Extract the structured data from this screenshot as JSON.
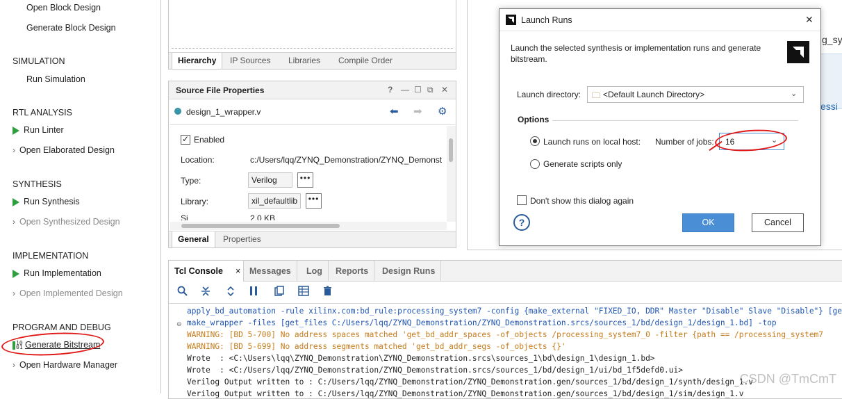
{
  "flow_navigator": {
    "open_block_design": "Open Block Design",
    "generate_block_design": "Generate Block Design",
    "simulation": "SIMULATION",
    "run_simulation": "Run Simulation",
    "rtl_analysis": "RTL ANALYSIS",
    "run_linter": "Run Linter",
    "open_elaborated_design": "Open Elaborated Design",
    "synthesis": "SYNTHESIS",
    "run_synthesis": "Run Synthesis",
    "open_synthesized_design": "Open Synthesized Design",
    "implementation": "IMPLEMENTATION",
    "run_implementation": "Run Implementation",
    "open_implemented_design": "Open Implemented Design",
    "program_and_debug": "PROGRAM AND DEBUG",
    "generate_bitstream": "Generate Bitstream",
    "open_hardware_manager": "Open Hardware Manager"
  },
  "sources_tabs": [
    "Hierarchy",
    "IP Sources",
    "Libraries",
    "Compile Order"
  ],
  "source_file_properties": {
    "title": "Source File Properties",
    "file_name": "design_1_wrapper.v",
    "enabled_label": "Enabled",
    "location_label": "Location:",
    "location_value": "c:/Users/lqq/ZYNQ_Demonstration/ZYNQ_Demonst",
    "type_label": "Type:",
    "type_value": "Verilog",
    "library_label": "Library:",
    "library_value": "xil_defaultlib",
    "size_label": "Si",
    "size_value": "2.0 KB",
    "tabs": [
      "General",
      "Properties"
    ],
    "dots": "•••"
  },
  "right_peek": {
    "text1": "g_sy",
    "text2": "essi"
  },
  "console": {
    "tabs": [
      "Tcl Console",
      "Messages",
      "Log",
      "Reports",
      "Design Runs"
    ],
    "close": "×",
    "lines": [
      {
        "type": "cmd",
        "text": "apply_bd_automation -rule xilinx.com:bd_rule:processing_system7 -config {make_external \"FIXED_IO, DDR\" Master \"Disable\" Slave \"Disable\"} [get_"
      },
      {
        "type": "cmd",
        "text": "make_wrapper -files [get_files C:/Users/lqq/ZYNQ_Demonstration/ZYNQ_Demonstration.srcs/sources_1/bd/design_1/design_1.bd] -top"
      },
      {
        "type": "warn",
        "text": "WARNING: [BD 5-700] No address spaces matched 'get_bd_addr_spaces -of_objects /processing_system7_0 -filter {path == /processing_system7"
      },
      {
        "type": "warn",
        "text": "WARNING: [BD 5-699] No address segments matched 'get_bd_addr_segs -of_objects {}'"
      },
      {
        "type": "out",
        "text": "Wrote  : <C:\\Users\\lqq\\ZYNQ_Demonstration\\ZYNQ_Demonstration.srcs\\sources_1\\bd\\design_1\\design_1.bd>"
      },
      {
        "type": "out",
        "text": "Wrote  : <C:/Users/lqq/ZYNQ_Demonstration/ZYNQ_Demonstration.srcs/sources_1/bd/design_1/ui/bd_1f5defd0.ui>"
      },
      {
        "type": "out",
        "text": "Verilog Output written to : C:/Users/lqq/ZYNQ_Demonstration/ZYNQ_Demonstration.gen/sources_1/bd/design_1/synth/design_1.v"
      },
      {
        "type": "out",
        "text": "Verilog Output written to : C:/Users/lqq/ZYNQ_Demonstration/ZYNQ_Demonstration.gen/sources_1/bd/design_1/sim/design_1.v"
      }
    ]
  },
  "dialog": {
    "title": "Launch Runs",
    "close": "✕",
    "description": "Launch the selected synthesis or implementation runs and generate bitstream.",
    "launch_directory_label": "Launch directory:",
    "launch_directory_value": "<Default Launch Directory>",
    "options_label": "Options",
    "local_host_label": "Launch runs on local host:",
    "jobs_label": "Number of jobs:",
    "jobs_value": "16",
    "scripts_only_label": "Generate scripts only",
    "dont_show_label": "Don't show this dialog again",
    "ok": "OK",
    "cancel": "Cancel",
    "help": "?"
  },
  "watermark": "CSDN @TmCmT",
  "colors": {
    "accent_blue": "#4a8fd6",
    "run_green": "#2e9e3e",
    "annotation_red": "#e01818",
    "warning": "#c67b1a",
    "command": "#1f55b5"
  }
}
